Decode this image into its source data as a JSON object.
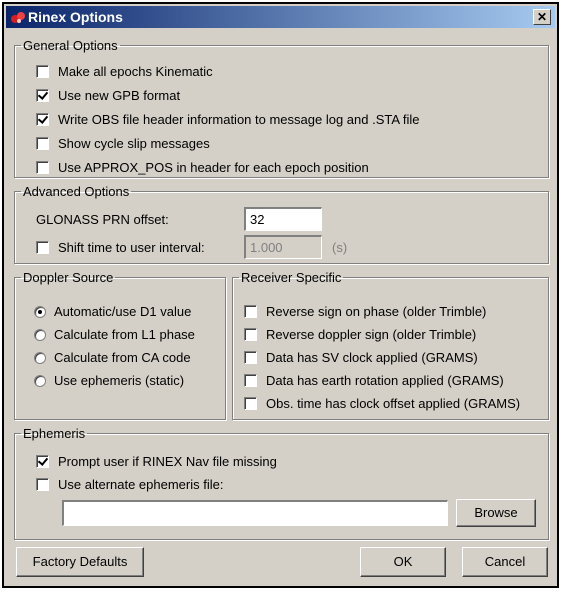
{
  "window": {
    "title": "Rinex Options",
    "close_glyph": "✕"
  },
  "general": {
    "legend": "General Options",
    "items": [
      {
        "label": "Make all epochs Kinematic",
        "checked": false
      },
      {
        "label": "Use new GPB format",
        "checked": true
      },
      {
        "label": "Write OBS file header information to message log and .STA file",
        "checked": true
      },
      {
        "label": "Show cycle slip messages",
        "checked": false
      },
      {
        "label": "Use APPROX_POS in header for each epoch position",
        "checked": false
      }
    ]
  },
  "advanced": {
    "legend": "Advanced Options",
    "glonass_label": "GLONASS PRN offset:",
    "glonass_value": "32",
    "shift_label": "Shift time to user interval:",
    "shift_checked": false,
    "shift_value": "1.000",
    "shift_unit": "(s)"
  },
  "doppler": {
    "legend": "Doppler Source",
    "options": [
      {
        "label": "Automatic/use D1 value",
        "selected": true
      },
      {
        "label": "Calculate from L1 phase",
        "selected": false
      },
      {
        "label": "Calculate from CA code",
        "selected": false
      },
      {
        "label": "Use ephemeris (static)",
        "selected": false
      }
    ]
  },
  "receiver": {
    "legend": "Receiver Specific",
    "items": [
      {
        "label": "Reverse sign on phase (older Trimble)",
        "checked": false
      },
      {
        "label": "Reverse doppler sign (older Trimble)",
        "checked": false
      },
      {
        "label": "Data has SV clock applied (GRAMS)",
        "checked": false
      },
      {
        "label": "Data has earth rotation applied (GRAMS)",
        "checked": false
      },
      {
        "label": "Obs. time has clock offset applied (GRAMS)",
        "checked": false
      }
    ]
  },
  "ephemeris": {
    "legend": "Ephemeris",
    "prompt_label": "Prompt user if RINEX Nav file missing",
    "prompt_checked": true,
    "alt_label": "Use alternate ephemeris file:",
    "alt_checked": false,
    "file_value": "",
    "browse_label": "Browse"
  },
  "footer": {
    "factory_label": "Factory Defaults",
    "ok_label": "OK",
    "cancel_label": "Cancel"
  },
  "colors": {
    "title_start": "#0a246a",
    "title_end": "#a6caf0",
    "face": "#d4d0c8"
  }
}
